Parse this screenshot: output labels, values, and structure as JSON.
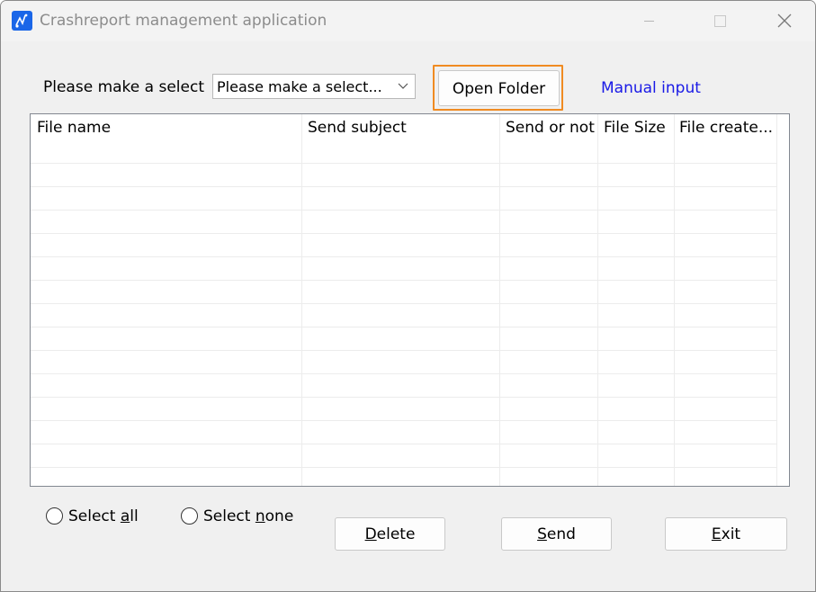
{
  "window": {
    "title": "Crashreport management application"
  },
  "toolbar": {
    "select_label": "Please make a select",
    "combo_value": "Please make a select...",
    "open_folder_label": "Open Folder",
    "manual_input_label": "Manual input"
  },
  "table": {
    "columns": [
      "File name",
      "Send subject",
      "Send or not",
      "File Size",
      "File create..."
    ],
    "rows": []
  },
  "footer": {
    "select_all": {
      "pre": "Select ",
      "key": "a",
      "post": "ll"
    },
    "select_none": {
      "pre": "Select ",
      "key": "n",
      "post": "one"
    },
    "delete": {
      "key": "D",
      "post": "elete"
    },
    "send": {
      "key": "S",
      "post": "end"
    },
    "exit": {
      "key": "E",
      "post": "xit"
    }
  },
  "colors": {
    "focus_outline": "#f08b22",
    "link": "#1a1ae6",
    "app_icon": "#1a66e8"
  }
}
